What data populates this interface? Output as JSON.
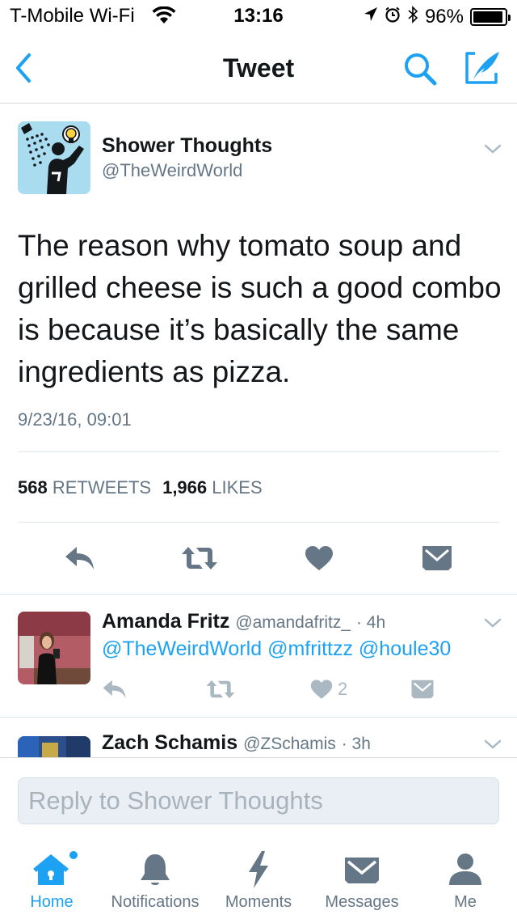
{
  "status_bar": {
    "carrier": "T-Mobile Wi-Fi",
    "time": "13:16",
    "battery": "96%",
    "battery_level": 0.96
  },
  "nav": {
    "title": "Tweet",
    "icons": [
      "back-chevron-icon",
      "search-icon",
      "compose-tweet-icon"
    ],
    "accent_color": "#1da1f2"
  },
  "tweet": {
    "author_name": "Shower Thoughts",
    "author_handle": "@TheWeirdWorld",
    "text": "The reason why tomato soup and grilled cheese is such a good combo is because it’s basically the same ingredients as pizza.",
    "timestamp": "9/23/16, 09:01",
    "retweet_count": "568",
    "retweet_label": "RETWEETS",
    "like_count": "1,966",
    "like_label": "LIKES"
  },
  "replies": [
    {
      "name": "Amanda Fritz",
      "handle": "@amandafritz_",
      "age": "· 4h",
      "text": "@TheWeirdWorld @mfrittzz @houle30",
      "like_count": "2"
    },
    {
      "name": "Zach Schamis",
      "handle": "@ZSchamis",
      "age": "· 3h"
    }
  ],
  "composer": {
    "placeholder": "Reply to Shower Thoughts"
  },
  "tabs": [
    {
      "label": "Home",
      "icon": "home-icon",
      "active": true
    },
    {
      "label": "Notifications",
      "icon": "bell-icon",
      "active": false
    },
    {
      "label": "Moments",
      "icon": "lightning-icon",
      "active": false
    },
    {
      "label": "Messages",
      "icon": "envelope-icon",
      "active": false
    },
    {
      "label": "Me",
      "icon": "person-icon",
      "active": false
    }
  ]
}
